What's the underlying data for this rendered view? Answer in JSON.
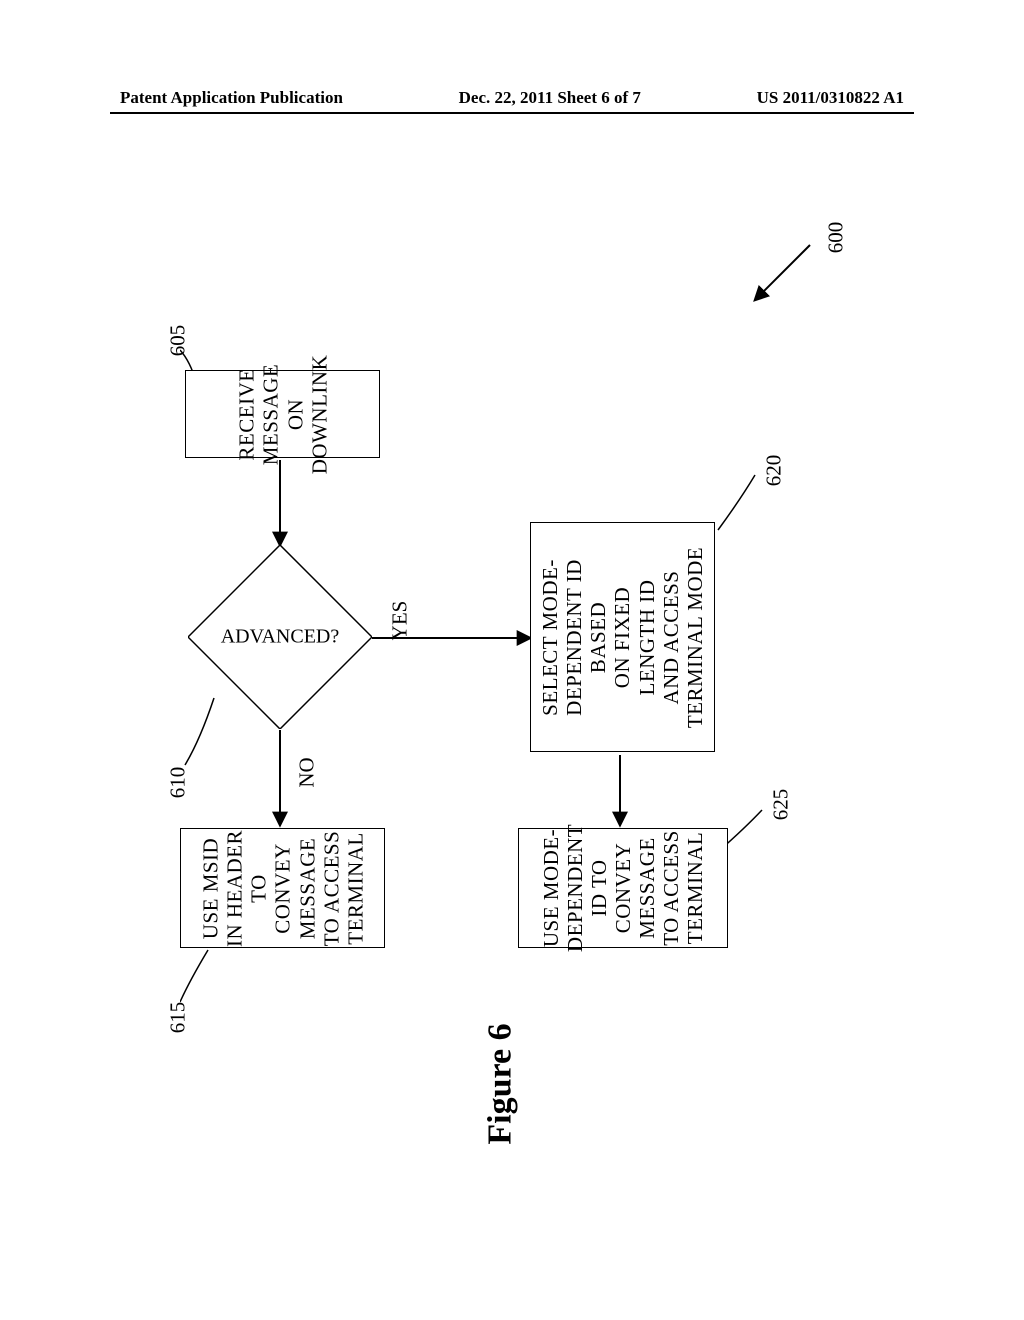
{
  "header": {
    "left": "Patent Application Publication",
    "center": "Dec. 22, 2011  Sheet 6 of 7",
    "right": "US 2011/0310822 A1"
  },
  "figure_caption": "Figure 6",
  "diagram_ref": "600",
  "boxes": {
    "b605": {
      "text": "RECEIVE MESSAGE ON\nDOWNLINK",
      "ref": "605"
    },
    "b615": {
      "text": "USE MSID IN HEADER\nTO CONVEY MESSAGE\nTO ACCESS TERMINAL",
      "ref": "615"
    },
    "b620": {
      "text": "SELECT MODE-\nDEPENDENT ID BASED\nON FIXED LENGTH ID\nAND ACCESS\nTERMINAL MODE",
      "ref": "620"
    },
    "b625": {
      "text": "USE MODE-DEPENDENT\nID TO CONVEY\nMESSAGE TO ACCESS\nTERMINAL",
      "ref": "625"
    }
  },
  "decision": {
    "text": "ADVANCED?",
    "ref": "610",
    "yes": "YES",
    "no": "NO"
  },
  "chart_data": {
    "type": "flowchart",
    "orientation": "top-down (rendered rotated -90deg on page)",
    "diagram_id": "600",
    "nodes": [
      {
        "id": "605",
        "type": "process",
        "label": "RECEIVE MESSAGE ON DOWNLINK"
      },
      {
        "id": "610",
        "type": "decision",
        "label": "ADVANCED?"
      },
      {
        "id": "615",
        "type": "process",
        "label": "USE MSID IN HEADER TO CONVEY MESSAGE TO ACCESS TERMINAL"
      },
      {
        "id": "620",
        "type": "process",
        "label": "SELECT MODE-DEPENDENT ID BASED ON FIXED LENGTH ID AND ACCESS TERMINAL MODE"
      },
      {
        "id": "625",
        "type": "process",
        "label": "USE MODE-DEPENDENT ID TO CONVEY MESSAGE TO ACCESS TERMINAL"
      }
    ],
    "edges": [
      {
        "from": "605",
        "to": "610",
        "label": ""
      },
      {
        "from": "610",
        "to": "615",
        "label": "NO"
      },
      {
        "from": "610",
        "to": "620",
        "label": "YES"
      },
      {
        "from": "620",
        "to": "625",
        "label": ""
      }
    ]
  }
}
